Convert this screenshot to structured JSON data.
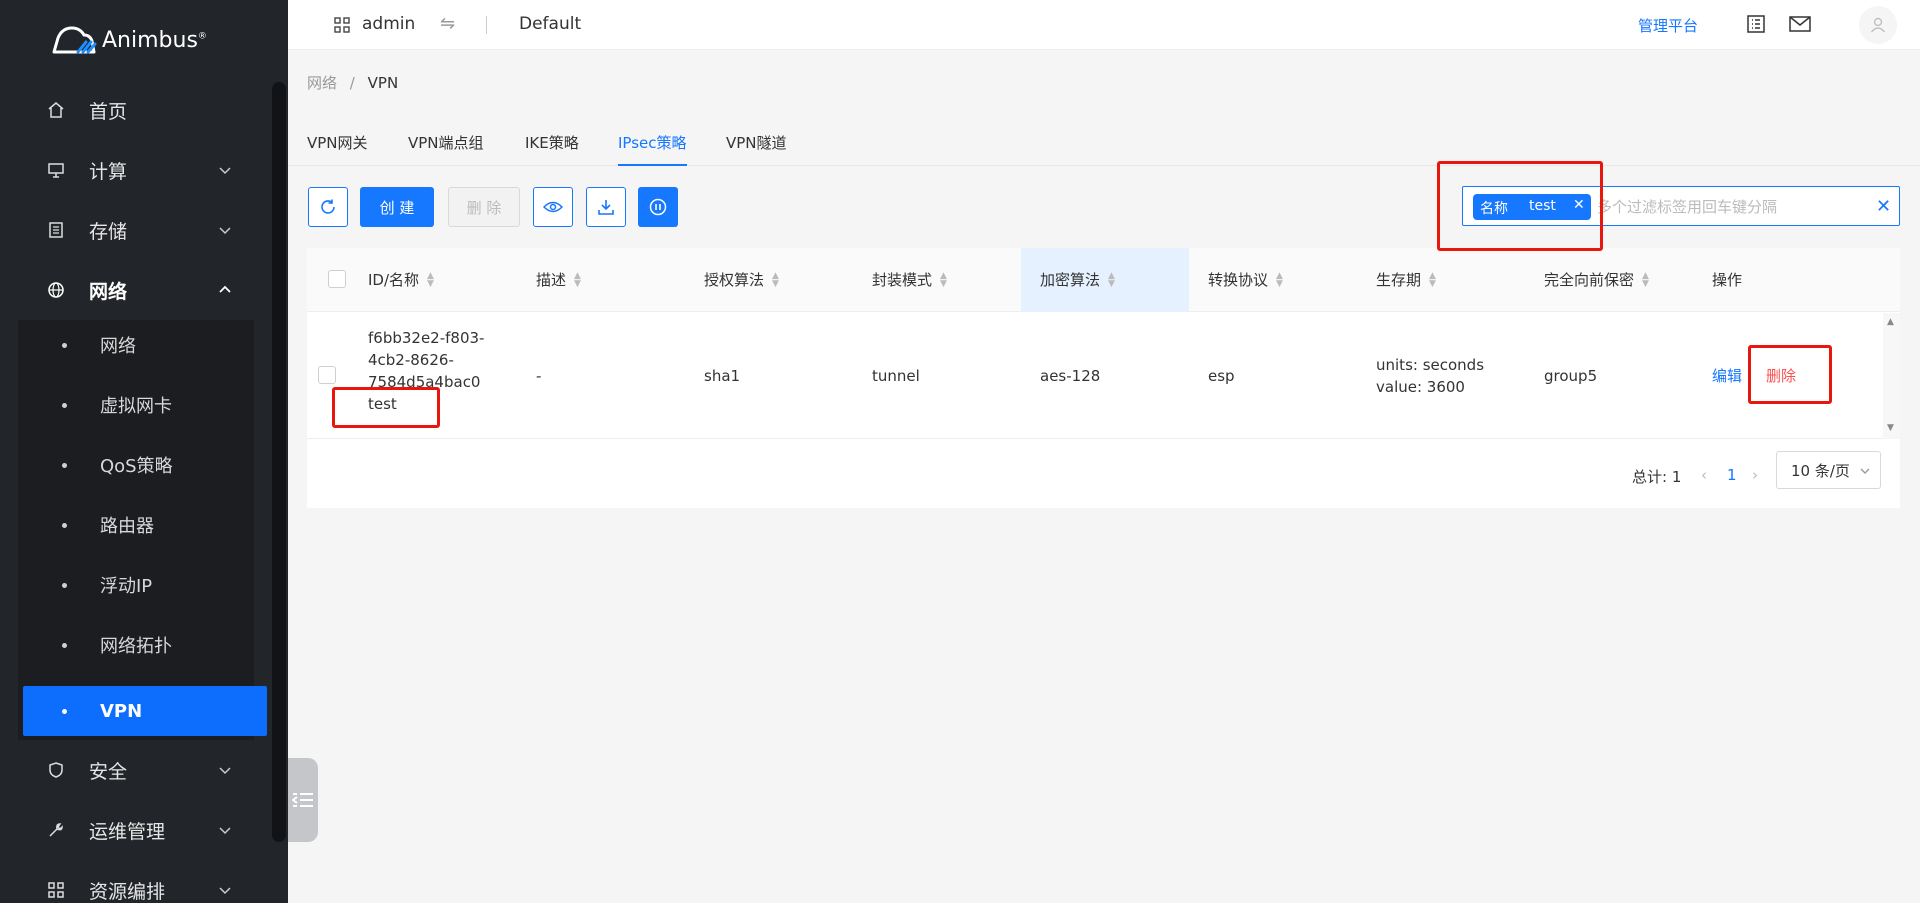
{
  "brand": {
    "name": "Animbus",
    "mark": "®"
  },
  "sidebar": {
    "items": [
      {
        "label": "首页",
        "icon": "home-icon"
      },
      {
        "label": "计算",
        "icon": "monitor-icon"
      },
      {
        "label": "存储",
        "icon": "storage-icon"
      },
      {
        "label": "网络",
        "icon": "globe-icon"
      },
      {
        "label": "安全",
        "icon": "shield-icon"
      },
      {
        "label": "运维管理",
        "icon": "wrench-icon"
      },
      {
        "label": "资源编排",
        "icon": "grid-icon"
      }
    ],
    "network_sub": [
      "网络",
      "虚拟网卡",
      "QoS策略",
      "路由器",
      "浮动IP",
      "网络拓扑",
      "VPN"
    ]
  },
  "topbar": {
    "user": "admin",
    "swap_glyph": "⇋",
    "project": "Default",
    "admin_link": "管理平台"
  },
  "breadcrumb": {
    "parent": "网络",
    "sep": "/",
    "current": "VPN"
  },
  "tabs": [
    "VPN网关",
    "VPN端点组",
    "IKE策略",
    "IPsec策略",
    "VPN隧道"
  ],
  "toolbar": {
    "create": "创 建",
    "delete": "删 除"
  },
  "filter": {
    "tag_key": "名称",
    "tag_value": "test",
    "placeholder": "多个过滤标签用回车键分隔"
  },
  "table": {
    "columns": [
      "ID/名称",
      "描述",
      "授权算法",
      "封装模式",
      "加密算法",
      "转换协议",
      "生存期",
      "完全向前保密",
      "操作"
    ],
    "rows": [
      {
        "id_lines": [
          "f6bb32e2-f803-",
          "4cb2-8626-",
          "7584d5a4bac0"
        ],
        "name": "test",
        "desc": "-",
        "auth": "sha1",
        "mode": "tunnel",
        "encrypt": "aes-128",
        "protocol": "esp",
        "lifetime_units": "units: seconds",
        "lifetime_value": "value: 3600",
        "pfs": "group5",
        "edit": "编辑",
        "delete": "删除"
      }
    ]
  },
  "pager": {
    "total_label": "总计:",
    "total": "1",
    "page": "1",
    "page_size": "10 条/页"
  },
  "colors": {
    "accent": "#1677ff",
    "sidebar_bg": "#22252a",
    "danger": "#ff4d4f",
    "annotation": "#e8160c"
  }
}
